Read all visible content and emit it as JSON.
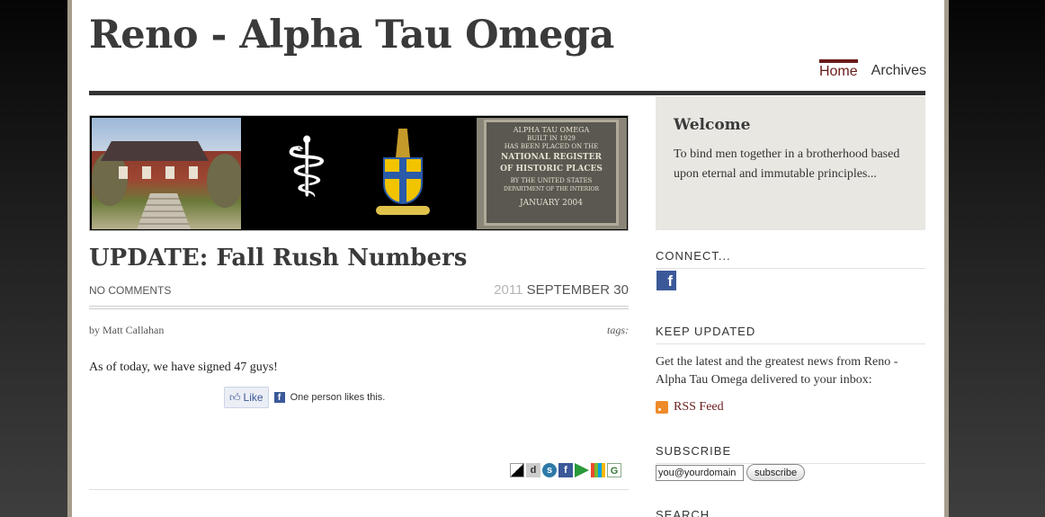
{
  "site": {
    "title": "Reno - Alpha Tau Omega"
  },
  "nav": {
    "items": [
      {
        "label": "Home",
        "active": true
      },
      {
        "label": "Archives",
        "active": false
      }
    ]
  },
  "banner": {
    "plaque_lines": [
      "ALPHA TAU OMEGA",
      "BUILT IN 1929",
      "HAS BEEN PLACED ON THE",
      "NATIONAL REGISTER",
      "OF HISTORIC PLACES",
      "BY THE UNITED STATES",
      "DEPARTMENT OF THE INTERIOR",
      "JANUARY 2004"
    ]
  },
  "post": {
    "title": "UPDATE: Fall Rush Numbers",
    "comments": "NO COMMENTS",
    "date_year": "2011",
    "date_day": "SEPTEMBER 30",
    "author": "by Matt Callahan",
    "tags_label": "tags:",
    "body": "As of today, we have signed 47 guys!",
    "like_label": "Like",
    "like_text": "One person likes this.",
    "share_icons": [
      "delicious-icon",
      "digg-icon",
      "stumbleupon-icon",
      "facebook-icon",
      "google-buzz-icon",
      "windows-live-icon",
      "google-icon"
    ]
  },
  "sidebar": {
    "welcome": {
      "title": "Welcome",
      "text": "To bind men together in a brotherhood based upon eternal and immutable principles..."
    },
    "connect_heading": "CONNECT...",
    "keep_heading": "KEEP UPDATED",
    "keep_text": "Get the latest and the greatest news from Reno - Alpha Tau Omega delivered to your inbox:",
    "rss_label": "RSS Feed",
    "subscribe_heading": "SUBSCRIBE",
    "email_value": "you@yourdomain",
    "subscribe_button": "subscribe",
    "search_heading": "SEARCH"
  },
  "colors": {
    "accent": "#6b1a1a",
    "title": "#3a3a3a",
    "facebook": "#3b5998"
  }
}
